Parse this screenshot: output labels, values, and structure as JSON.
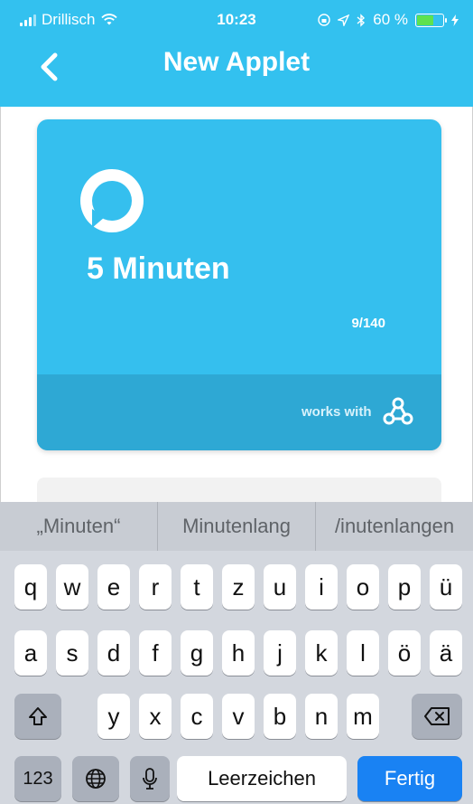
{
  "status_bar": {
    "carrier": "Drillisch",
    "time": "10:23",
    "battery": "60 %"
  },
  "header": {
    "title": "New Applet"
  },
  "card": {
    "title": "5 Minuten",
    "char_count": "9/140",
    "works_with": "works with"
  },
  "keyboard": {
    "suggestions": [
      "„Minuten“",
      "Minutenlang",
      "/inutenlangen"
    ],
    "row1": [
      "q",
      "w",
      "e",
      "r",
      "t",
      "z",
      "u",
      "i",
      "o",
      "p",
      "ü"
    ],
    "row2": [
      "a",
      "s",
      "d",
      "f",
      "g",
      "h",
      "j",
      "k",
      "l",
      "ö",
      "ä"
    ],
    "row3": [
      "y",
      "x",
      "c",
      "v",
      "b",
      "n",
      "m"
    ],
    "numbers_label": "123",
    "space_label": "Leerzeichen",
    "done_label": "Fertig"
  },
  "colors": {
    "header": "#33c1ef",
    "card": "#35bfee",
    "card_footer": "#2ea8d4",
    "done_key": "#1982f3"
  }
}
